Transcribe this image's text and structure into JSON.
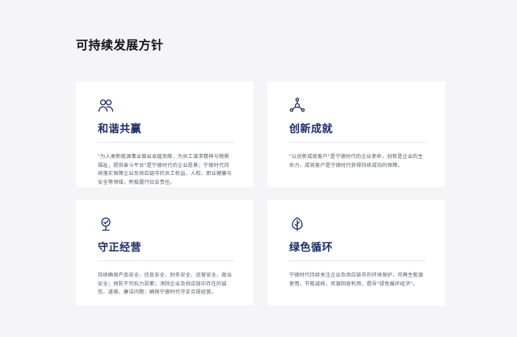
{
  "page": {
    "title": "可持续发展方针"
  },
  "cards": [
    {
      "icon": "people-icon",
      "title": "和谐共赢",
      "text": "\"为人类新能源事业做出卓越贡献，为员工谋求精神与物质福祉，提供奋斗平台\"是宁德时代的企业愿景；宁德时代持续落实保障企业及供应链中的员工权益、人权、职业健康与安全等领域，积极履行社会责任。"
    },
    {
      "icon": "molecule-icon",
      "title": "创新成就",
      "text": "\"以创新成就客户\"是宁德时代的企业使命，创新是企业的生命力，成就客户是宁德时代获得持续成功的保障。"
    },
    {
      "icon": "compliance-icon",
      "title": "守正经营",
      "text": "持续确保产品安全、信息安全、财务安全、运营安全、政治安全；预防不可抗力因素；消除企业及供应链中存在的诚信、道德、廉洁问题；确保宁德时代守正合规经营。"
    },
    {
      "icon": "leaf-icon",
      "title": "绿色循环",
      "text": "宁德时代持续关注企业及供应链中的环境保护，可再生能源使用，节能减排，资源回收利用，倡导\"绿色循环经济\"。"
    }
  ],
  "colors": {
    "background": "#f5f5f7",
    "card": "#ffffff",
    "title": "#1b2d6b",
    "text": "#555b66"
  }
}
